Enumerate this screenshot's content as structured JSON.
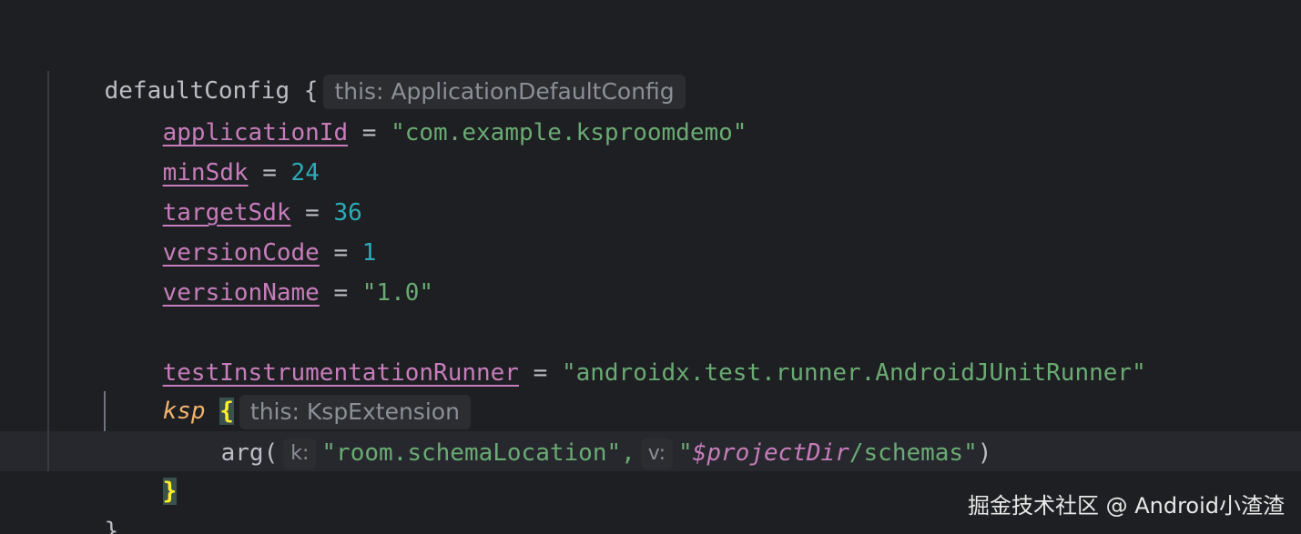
{
  "code": {
    "l1_ident": "defaultConfig",
    "l1_brace": "{",
    "l1_hint": "this: ApplicationDefaultConfig",
    "l2_prop": "applicationId",
    "l2_eq": " = ",
    "l2_val": "\"com.example.ksproomdemo\"",
    "l3_prop": "minSdk",
    "l3_eq": " = ",
    "l3_val": "24",
    "l4_prop": "targetSdk",
    "l4_eq": " = ",
    "l4_val": "36",
    "l5_prop": "versionCode",
    "l5_eq": " = ",
    "l5_val": "1",
    "l6_prop": "versionName",
    "l6_eq": " = ",
    "l6_val": "\"1.0\"",
    "l8_prop": "testInstrumentationRunner",
    "l8_eq": " = ",
    "l8_val": "\"androidx.test.runner.AndroidJUnitRunner\"",
    "l9_fn": "ksp",
    "l9_brace": "{",
    "l9_hint": "this: KspExtension",
    "l10_fn": "arg(",
    "l10_hint_k": "k:",
    "l10_arg1": "\"room.schemaLocation\",",
    "l10_hint_v": "v:",
    "l10_q1": "\"",
    "l10_tmpl": "$projectDir",
    "l10_rest": "/schemas\"",
    "l10_close": ")",
    "l11_brace": "}",
    "l12_brace": "}"
  },
  "watermark": "掘金技术社区 @ Android小渣渣",
  "colors": {
    "background": "#1e1f22",
    "property": "#c77dbb",
    "string": "#6aab73",
    "number": "#2aacb8",
    "function_italic": "#f0b36a",
    "brace_highlight": "#ffef28"
  }
}
